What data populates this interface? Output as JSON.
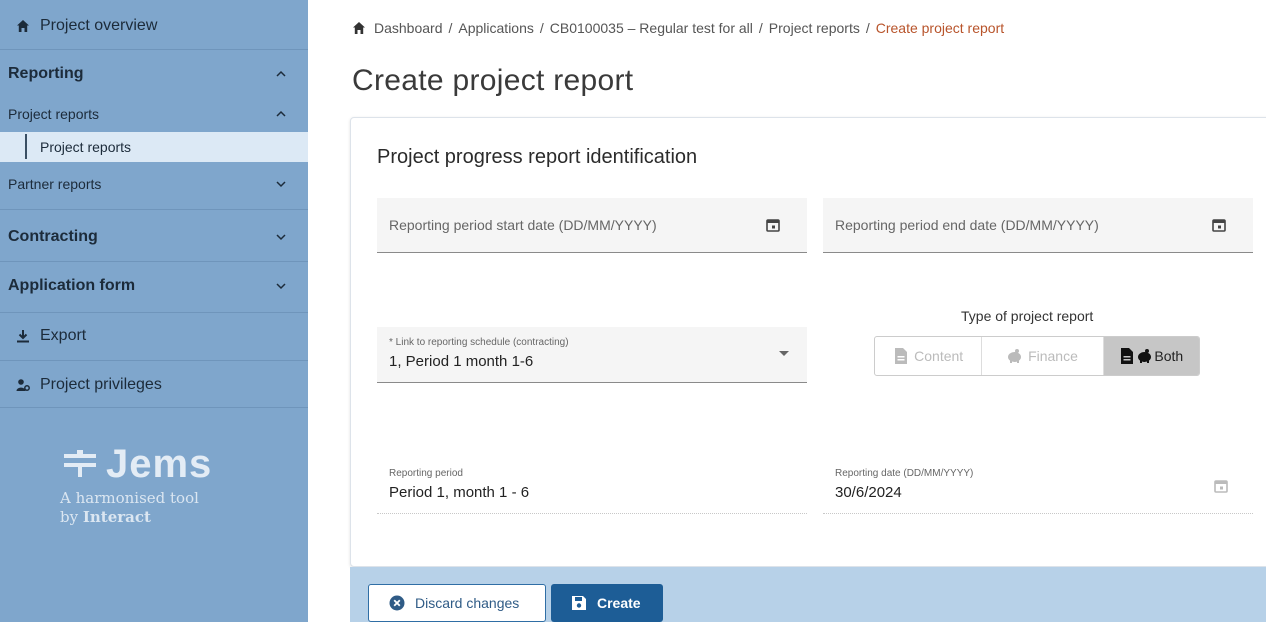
{
  "sidebar": {
    "project_overview": "Project overview",
    "reporting": "Reporting",
    "project_reports_group": "Project reports",
    "project_reports_item": "Project reports",
    "partner_reports": "Partner reports",
    "contracting": "Contracting",
    "application_form": "Application form",
    "export": "Export",
    "project_privileges": "Project privileges",
    "logo_name": "Jems",
    "logo_tagline1": "A harmonised tool",
    "logo_tagline2_prefix": "by ",
    "logo_tagline2_brand": "Interact",
    "icons": {
      "home": "home-icon",
      "export": "download-icon",
      "privileges": "user-gear-icon"
    }
  },
  "breadcrumb": {
    "items": [
      "Dashboard",
      "Applications",
      "CB0100035 – Regular test for all",
      "Project reports"
    ],
    "current": "Create project report",
    "separator": "/"
  },
  "page": {
    "title": "Create project report"
  },
  "form": {
    "section_title": "Project progress report identification",
    "start_date_placeholder": "Reporting period start date (DD/MM/YYYY)",
    "end_date_placeholder": "Reporting period end date (DD/MM/YYYY)",
    "schedule_label": "* Link to reporting schedule (contracting)",
    "schedule_value": "1, Period 1 month 1-6",
    "type_label": "Type of project report",
    "type_options": [
      "Content",
      "Finance",
      "Both"
    ],
    "type_selected": "Both",
    "reporting_period_label": "Reporting period",
    "reporting_period_value": "Period 1, month 1 - 6",
    "reporting_date_label": "Reporting date (DD/MM/YYYY)",
    "reporting_date_value": "30/6/2024"
  },
  "actions": {
    "discard": "Discard changes",
    "create": "Create"
  },
  "colors": {
    "sidebar_bg": "#7fa6cc",
    "active_item_bg": "#dce9f5",
    "breadcrumb_current": "#b8542b",
    "primary_button": "#1d5d96",
    "footer_bar": "#b7d1e8"
  }
}
